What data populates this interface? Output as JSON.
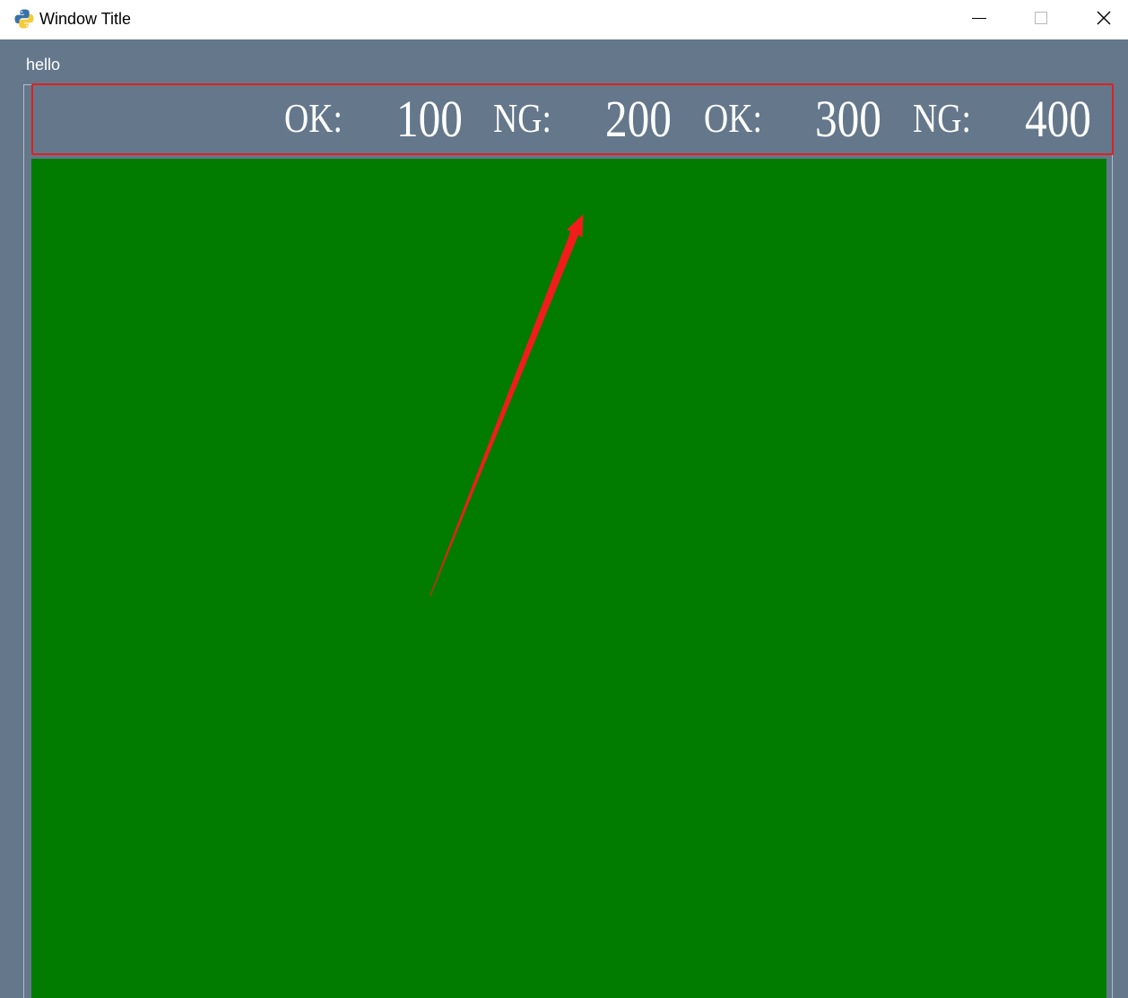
{
  "window": {
    "title": "Window Title",
    "icon": "python-icon",
    "controls": {
      "minimize": "minimize-icon",
      "maximize": "maximize-icon",
      "close": "close-icon"
    }
  },
  "groupbox": {
    "title": "hello"
  },
  "counters": [
    {
      "label": "OK:",
      "value": "100"
    },
    {
      "label": "NG:",
      "value": "200"
    },
    {
      "label": "OK:",
      "value": "300"
    },
    {
      "label": "NG:",
      "value": "400"
    }
  ],
  "colors": {
    "background": "#64778b",
    "view": "#017c00",
    "highlight": "#e02020",
    "text": "#ffffff"
  }
}
